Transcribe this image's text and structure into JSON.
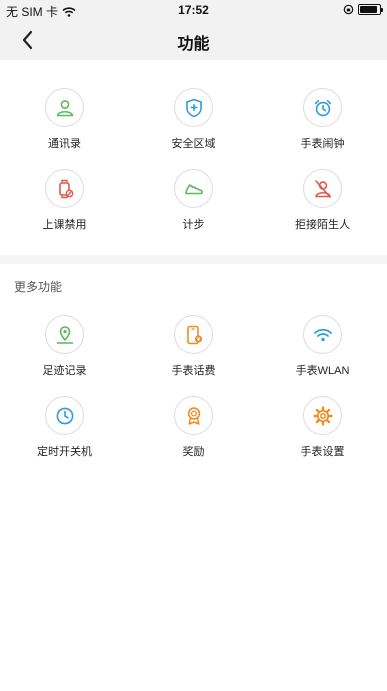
{
  "status_bar": {
    "carrier": "无 SIM 卡",
    "time": "17:52",
    "battery_level": 0.9
  },
  "nav": {
    "title": "功能",
    "back_icon": "chevron-left-icon"
  },
  "section_main": {
    "items": [
      {
        "label": "通讯录",
        "icon": "contacts-icon",
        "color": "#5cb85c"
      },
      {
        "label": "安全区域",
        "icon": "safe-zone-icon",
        "color": "#2e9be0"
      },
      {
        "label": "手表闹钟",
        "icon": "alarm-clock-icon",
        "color": "#2e9be0"
      },
      {
        "label": "上课禁用",
        "icon": "class-disable-icon",
        "color": "#e05a4c"
      },
      {
        "label": "计步",
        "icon": "shoe-icon",
        "color": "#5cb85c"
      },
      {
        "label": "拒接陌生人",
        "icon": "reject-stranger-icon",
        "color": "#e05a4c"
      }
    ]
  },
  "section_more": {
    "heading": "更多功能",
    "items": [
      {
        "label": "足迹记录",
        "icon": "footprint-icon",
        "color": "#5cb85c"
      },
      {
        "label": "手表话费",
        "icon": "phone-bill-icon",
        "color": "#f08a24"
      },
      {
        "label": "手表WLAN",
        "icon": "wifi-icon",
        "color": "#2e9be0"
      },
      {
        "label": "定时开关机",
        "icon": "timer-clock-icon",
        "color": "#2e9be0"
      },
      {
        "label": "奖励",
        "icon": "award-icon",
        "color": "#f08a24"
      },
      {
        "label": "手表设置",
        "icon": "gear-icon",
        "color": "#f08a24"
      }
    ]
  }
}
